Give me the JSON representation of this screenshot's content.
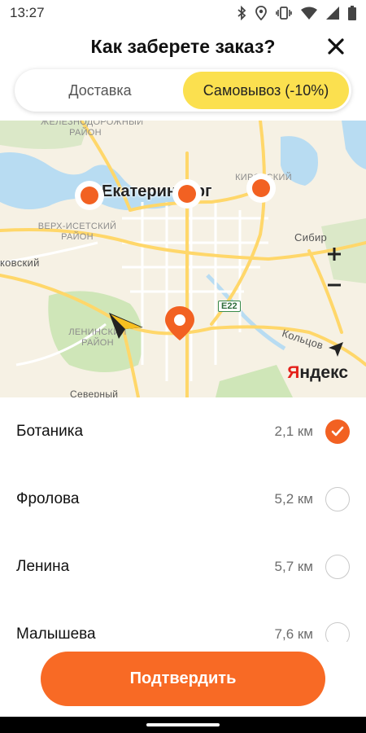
{
  "status": {
    "time": "13:27"
  },
  "header": {
    "title": "Как заберете заказ?"
  },
  "tabs": [
    {
      "label": "Доставка",
      "active": false
    },
    {
      "label": "Самовывоз (-10%)",
      "active": true
    }
  ],
  "map": {
    "city": "Екатеринбург",
    "district_labels": [
      "ЖЕЛЕЗНОДОРОЖНЫЙ РАЙОН",
      "ВЕРХ-ИСЕТСКИЙ РАЙОН",
      "ЛЕНИНСКИЙ РАЙОН",
      "КИРОВСКИЙ"
    ],
    "place_labels": [
      "ковский",
      "Сибир",
      "Кольцов",
      "Северный"
    ],
    "road_badge": "E22",
    "logo": {
      "first": "Я",
      "rest": "ндекс"
    }
  },
  "pickup_points": [
    {
      "name": "Ботаника",
      "distance": "2,1 км",
      "selected": true
    },
    {
      "name": "Фролова",
      "distance": "5,2 км",
      "selected": false
    },
    {
      "name": "Ленина",
      "distance": "5,7 км",
      "selected": false
    },
    {
      "name": "Малышева",
      "distance": "7,6 км",
      "selected": false
    }
  ],
  "confirm_label": "Подтвердить",
  "colors": {
    "accent": "#f86a25",
    "tab_active": "#fbe04f",
    "map_bg": "#f6f1e4",
    "water": "#b8dcf2",
    "park": "#cfe6b8"
  }
}
